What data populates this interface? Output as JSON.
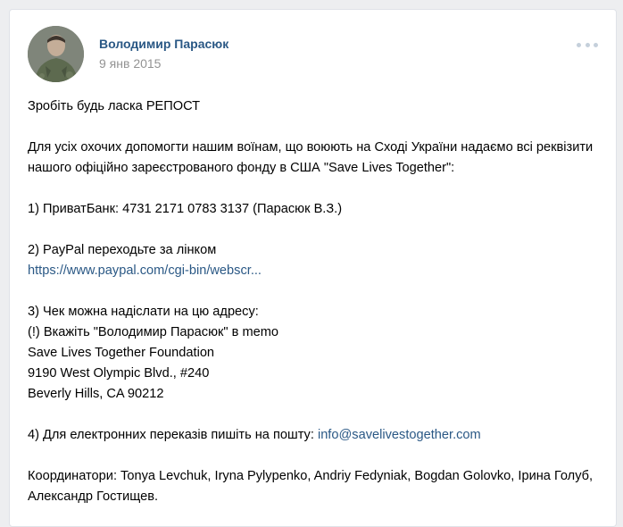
{
  "post": {
    "author": "Володимир Парасюк",
    "date": "9 янв 2015",
    "text": {
      "l1": "Зробіть будь ласка РЕПОСТ",
      "l2": "Для усіх охочих допомогти нашим воїнам, що воюють на Сході України надаємо всі реквізити нашого офіційно зареєстрованого фонду в США \"Save Lives Together\":",
      "l3": "1) ПриватБанк: 4731 2171 0783 3137 (Парасюк В.З.)",
      "l4": "2) PayPal переходьте за лінком",
      "paypal_link": "https://www.paypal.com/cgi-bin/webscr...",
      "l5": "3) Чек можна надіслати на цю адресу:",
      "l6": "(!) Вкажіть \"Володимир Парасюк\" в memo",
      "l7": "Save Lives Together Foundation",
      "l8": "9190 West Olympic Blvd., #240",
      "l9": "Beverly Hills, CA 90212",
      "l10_prefix": "4) Для електронних переказів пишіть на пошту: ",
      "email": "info@savelivestogether.com",
      "l11": "Координатори: Tonya Levchuk, Iryna Pylypenko, Andriy Fedyniak, Bogdan Golovko, Ірина Голуб, Александр Гостищев."
    }
  },
  "colors": {
    "link": "#2a5885",
    "date": "#939393",
    "bg": "#edeef0",
    "more_dots": "#c5d0db"
  },
  "icons": {
    "more": "more-horizontal-icon"
  }
}
